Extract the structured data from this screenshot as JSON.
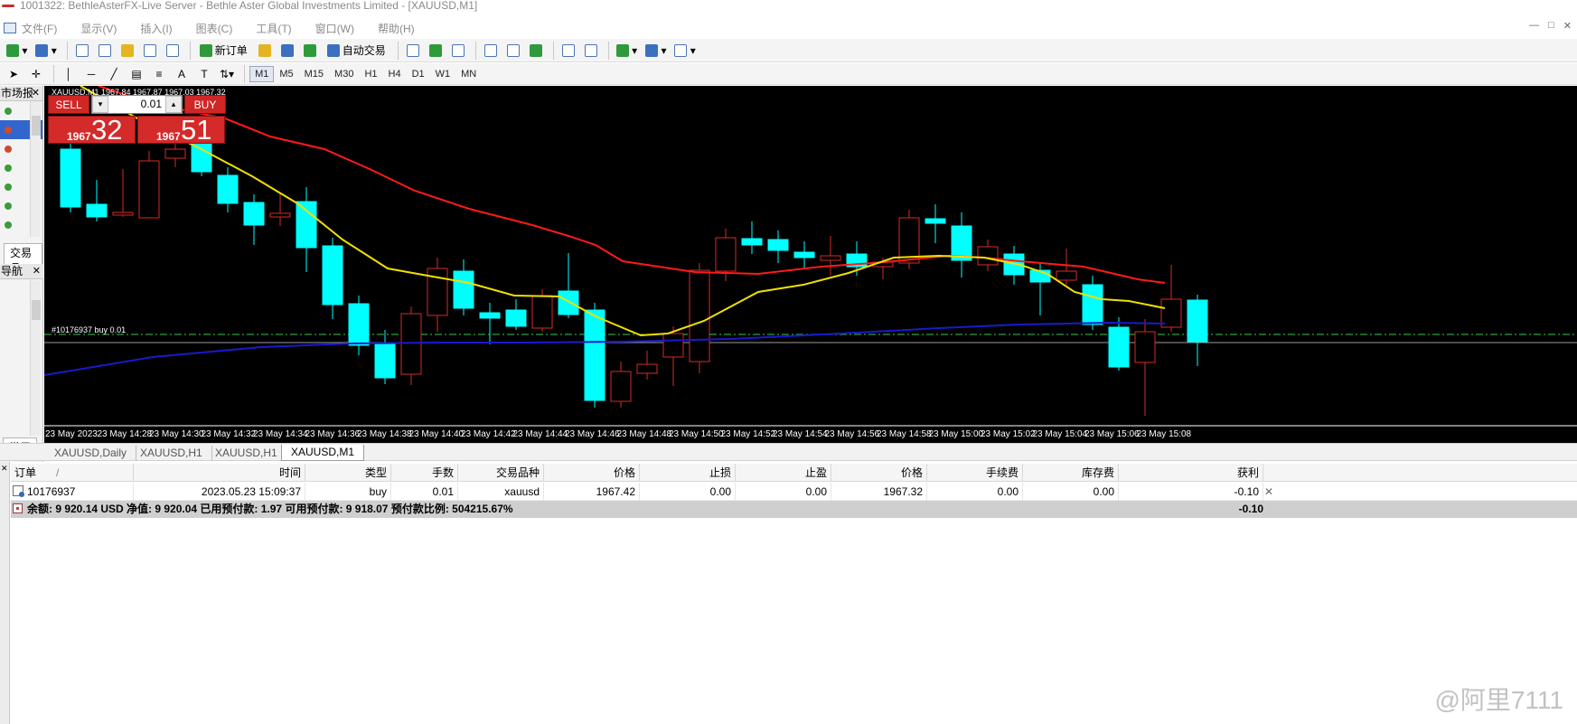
{
  "window": {
    "title": "1001322: BethleAsterFX-Live Server - Bethle Aster Global Investments Limited - [XAUUSD,M1]",
    "controls": [
      "—",
      "□",
      "✕"
    ]
  },
  "menu": [
    "文件(F)",
    "显示(V)",
    "插入(I)",
    "图表(C)",
    "工具(T)",
    "窗口(W)",
    "帮助(H)"
  ],
  "toolbar": {
    "new_order_label": "新订单",
    "auto_trading_label": "自动交易"
  },
  "timeframes": [
    "M1",
    "M5",
    "M15",
    "M30",
    "H1",
    "H4",
    "D1",
    "W1",
    "MN"
  ],
  "active_timeframe": "M1",
  "left_panel": {
    "market_watch_title": "市场报",
    "trading_tab": "交易品",
    "navigator_title": "导航",
    "common_tab": "常用"
  },
  "chart": {
    "header": "XAUUSD,M1  1967.84 1967.87 1967.03 1967.32",
    "order_line_label": "#10176937 buy 0.01",
    "one_click": {
      "sell_label": "SELL",
      "buy_label": "BUY",
      "lot": "0.01",
      "bid_prefix": "1967",
      "bid_big": "32",
      "ask_prefix": "1967",
      "ask_big": "51"
    },
    "colors": {
      "bull": "#000000",
      "bear": "#00ffff",
      "bull_outline": "#d62a2a",
      "ma_fast": "#f0e000",
      "ma_mid": "#ff1a1a",
      "ma_slow": "#1a1acc",
      "order_line": "#2ea043"
    },
    "time_labels": [
      "23 May 2023",
      "23 May 14:28",
      "23 May 14:30",
      "23 May 14:32",
      "23 May 14:34",
      "23 May 14:36",
      "23 May 14:38",
      "23 May 14:40",
      "23 May 14:42",
      "23 May 14:44",
      "23 May 14:46",
      "23 May 14:48",
      "23 May 14:50",
      "23 May 14:52",
      "23 May 14:54",
      "23 May 14:56",
      "23 May 14:58",
      "23 May 15:00",
      "23 May 15:02",
      "23 May 15:04",
      "23 May 15:06",
      "23 May 15:08"
    ]
  },
  "chart_tabs": [
    "XAUUSD,Daily",
    "XAUUSD,H1",
    "XAUUSD,H1",
    "XAUUSD,M1"
  ],
  "terminal": {
    "columns": [
      "订单",
      "时间",
      "类型",
      "手数",
      "交易品种",
      "价格",
      "止损",
      "止盈",
      "价格",
      "手续费",
      "库存费",
      "获利"
    ],
    "sort_mark": "/",
    "rows": [
      [
        "10176937",
        "2023.05.23 15:09:37",
        "buy",
        "0.01",
        "xauusd",
        "1967.42",
        "0.00",
        "0.00",
        "1967.32",
        "0.00",
        "0.00",
        "-0.10"
      ]
    ],
    "summary": "余额: 9 920.14 USD  净值: 9 920.04  已用预付款: 1.97  可用预付款: 9 918.07  预付款比例: 504215.67%",
    "summary_profit": "-0.10"
  },
  "watermark": "@阿里7111"
}
